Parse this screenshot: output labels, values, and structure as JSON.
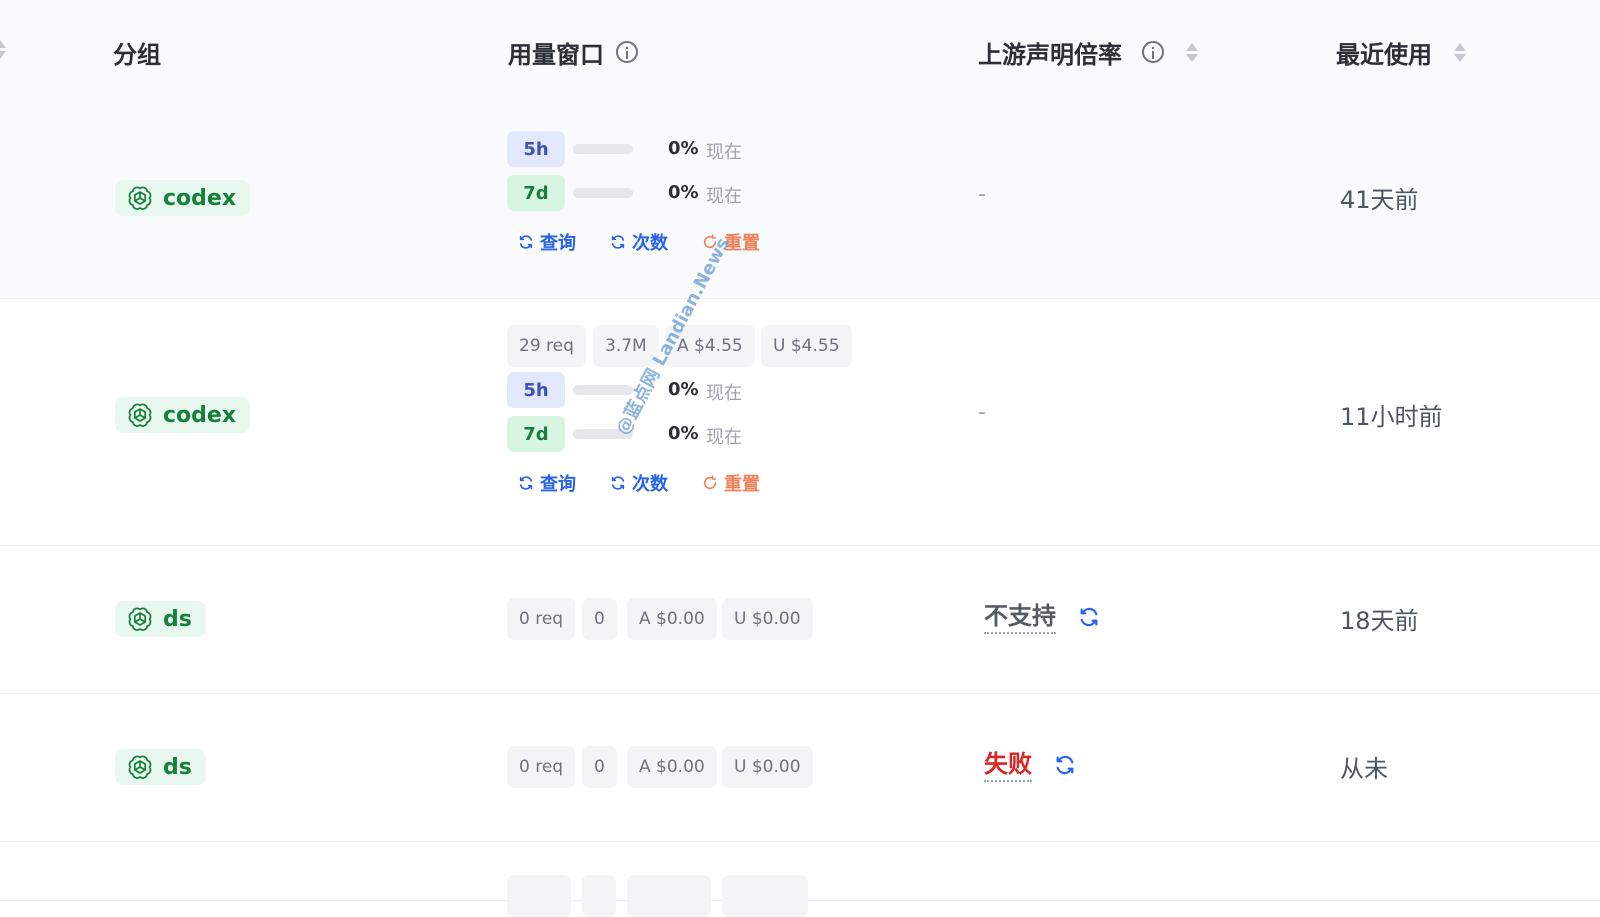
{
  "header": {
    "group": "分组",
    "usage_window": "用量窗口",
    "upstream_rate": "上游声明倍率",
    "last_used": "最近使用"
  },
  "rows": [
    {
      "group": "codex",
      "windows": [
        {
          "label": "5h",
          "percent_text": "0%",
          "progress": 0,
          "reset": "现在"
        },
        {
          "label": "7d",
          "percent_text": "0%",
          "progress": 0,
          "reset": "现在"
        }
      ],
      "actions": {
        "query": "查询",
        "count": "次数",
        "reset": "重置"
      },
      "upstream": "-",
      "last_used": "41天前"
    },
    {
      "group": "codex",
      "stats": [
        "29 req",
        "3.7M",
        "A $4.55",
        "U $4.55"
      ],
      "windows": [
        {
          "label": "5h",
          "percent_text": "0%",
          "progress": 0,
          "reset": "现在"
        },
        {
          "label": "7d",
          "percent_text": "0%",
          "progress": 0,
          "reset": "现在"
        }
      ],
      "actions": {
        "query": "查询",
        "count": "次数",
        "reset": "重置"
      },
      "upstream": "-",
      "last_used": "11小时前"
    },
    {
      "group": "ds",
      "stats": [
        "0 req",
        "0",
        "A $0.00",
        "U $0.00"
      ],
      "upstream": "不支持",
      "upstream_status": "unsupported",
      "last_used": "18天前"
    },
    {
      "group": "ds",
      "stats": [
        "0 req",
        "0",
        "A $0.00",
        "U $0.00"
      ],
      "upstream": "失败",
      "upstream_status": "failed",
      "last_used": "从未"
    }
  ],
  "watermark": "@蓝点网 Landian.News",
  "colors": {
    "group_bg": "#e9f8ee",
    "group_text": "#16803c",
    "chip_5h_bg": "#e2e8fc",
    "chip_7d_bg": "#d8f5e1",
    "link_blue": "#2563eb",
    "reset_orange": "#f0825a",
    "failed_red": "#dc2626"
  },
  "icons": {
    "group": "openai-logo-icon",
    "refresh": "refresh-icon",
    "reset": "rotate-cw-icon",
    "info": "info-circle-icon",
    "sort": "sort-icon"
  }
}
